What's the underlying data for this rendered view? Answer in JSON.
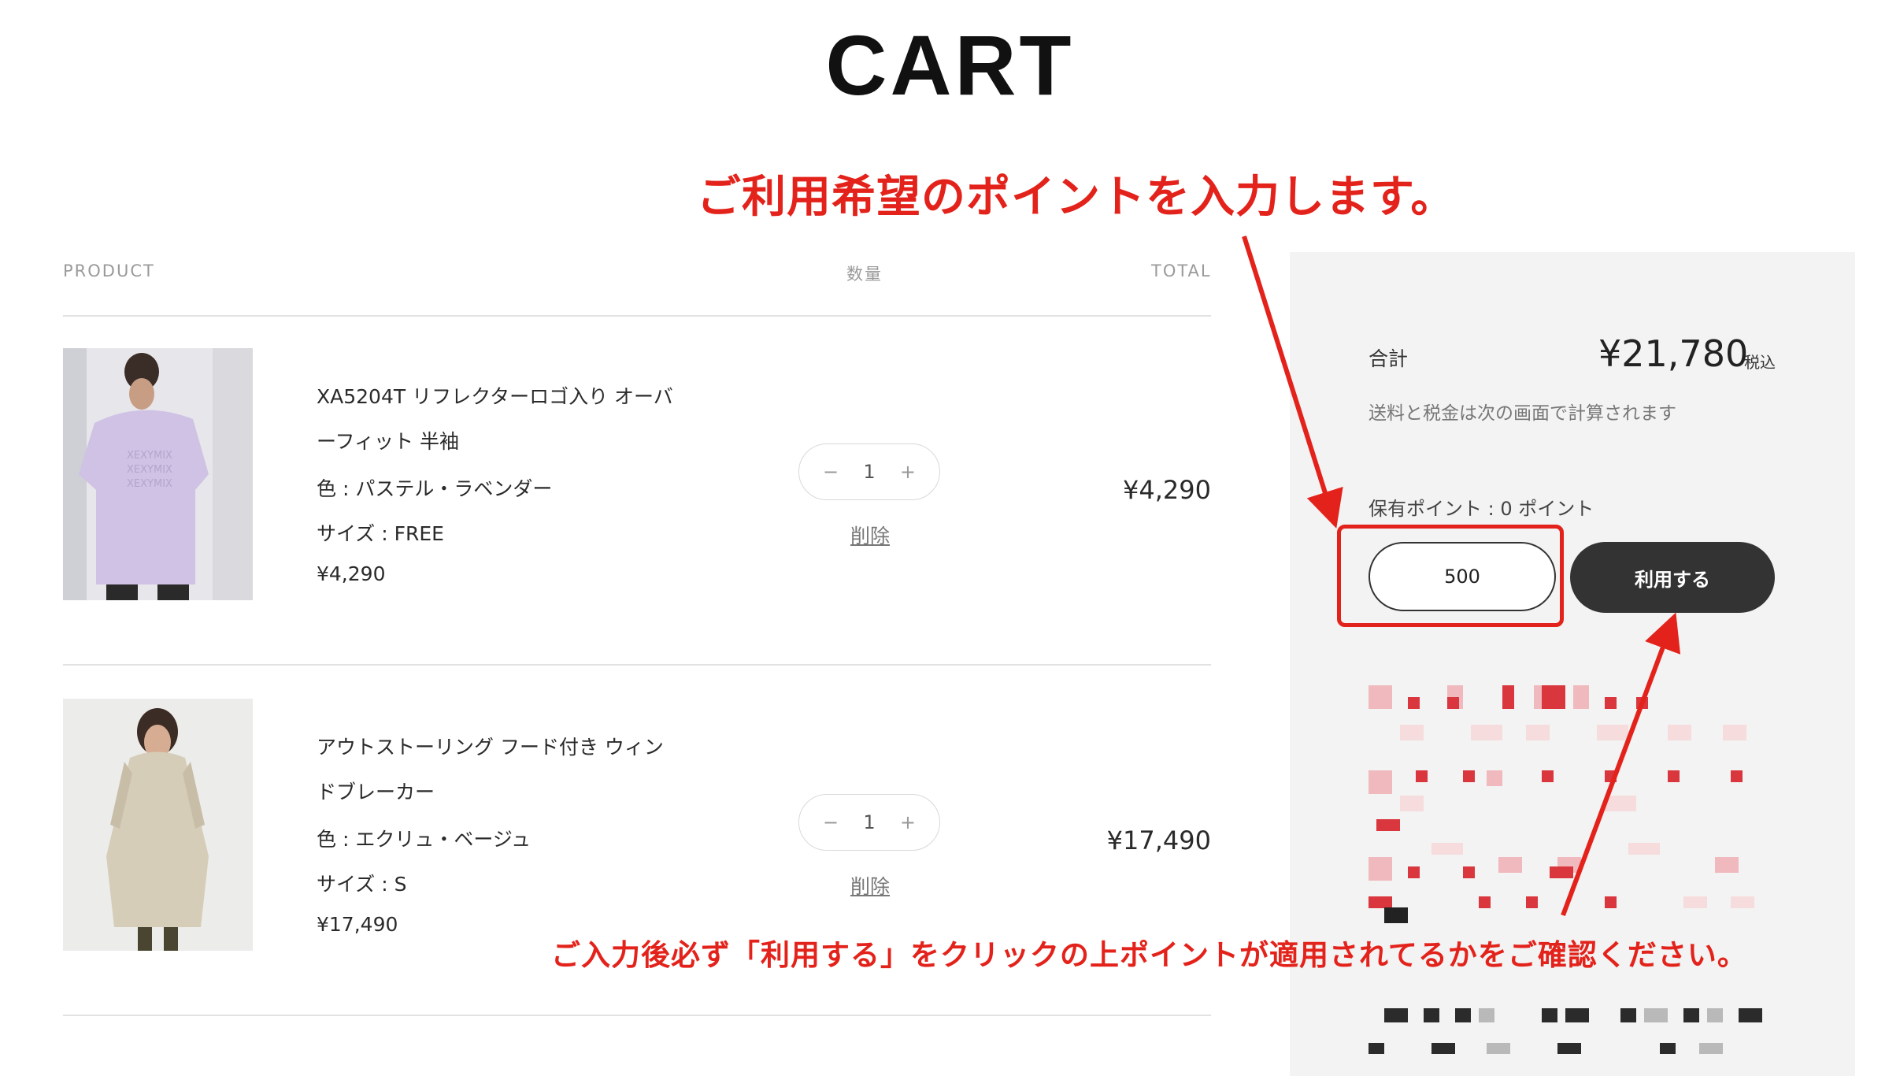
{
  "page": {
    "title": "CART"
  },
  "annotations": {
    "top": "ご利用希望のポイントを入力します。",
    "bottom": "ご入力後必ず「利用する」をクリックの上ポイントが適用されてるかをご確認ください。"
  },
  "table": {
    "headers": {
      "product": "PRODUCT",
      "quantity": "数量",
      "total": "TOTAL"
    }
  },
  "items": [
    {
      "name": "XA5204T リフレクターロゴ入り オーバーフィット 半袖",
      "color": "色 : パステル・ラベンダー",
      "size": "サイズ : FREE",
      "price": "¥4,290",
      "qty": "1",
      "minus": "−",
      "plus": "+",
      "remove": "削除",
      "total": "¥4,290"
    },
    {
      "name": "アウトストーリング フード付き ウィンドブレーカー",
      "color": "色 : エクリュ・ベージュ",
      "size": "サイズ : S",
      "price": "¥17,490",
      "qty": "1",
      "minus": "−",
      "plus": "+",
      "remove": "削除",
      "total": "¥17,490"
    }
  ],
  "summary": {
    "total_label": "合計",
    "total_value": "¥21,780",
    "tax_label": "税込",
    "note": "送料と税金は次の画面で計算されます",
    "points_held": "保有ポイント : 0 ポイント",
    "points_value": "500",
    "apply_label": "利用する"
  },
  "colors": {
    "annotation": "#e3231b",
    "button": "#333333",
    "panel": "#f3f3f3"
  }
}
